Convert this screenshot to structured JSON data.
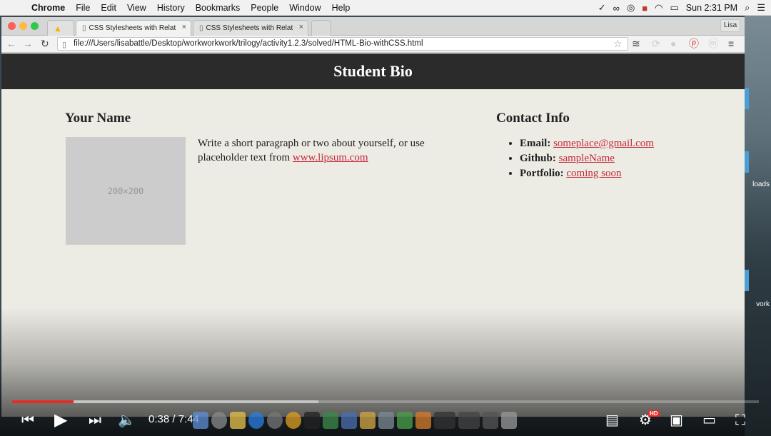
{
  "menubar": {
    "app": "Chrome",
    "items": [
      "File",
      "Edit",
      "View",
      "History",
      "Bookmarks",
      "People",
      "Window",
      "Help"
    ],
    "clock": "Sun 2:31 PM"
  },
  "desktop": {
    "labels": [
      "loads",
      "vork"
    ]
  },
  "browser": {
    "tabs": [
      {
        "title": "CSS Stylesheets with Relat",
        "active": true
      },
      {
        "title": "CSS Stylesheets with Relat",
        "active": false
      }
    ],
    "profile": "Lisa",
    "url": "file:///Users/lisabattle/Desktop/workworkwork/trilogy/activity1.2.3/solved/HTML-Bio-withCSS.html"
  },
  "page": {
    "header": "Student Bio",
    "name_heading": "Your Name",
    "photo_placeholder": "200×200",
    "bio_text": "Write a short paragraph or two about yourself, or use placeholder text from ",
    "bio_link": "www.lipsum.com",
    "contact_heading": "Contact Info",
    "contacts": [
      {
        "label": "Email:",
        "value": "someplace@gmail.com"
      },
      {
        "label": "Github:",
        "value": "sampleName"
      },
      {
        "label": "Portfolio:",
        "value": "coming soon"
      }
    ],
    "link_color": "#c6283a"
  },
  "video": {
    "time": "0:38 / 7:44",
    "progress_fraction": 0.082,
    "buffered_fraction": 0.41,
    "hd_badge": "HD"
  },
  "colors": {
    "header_bg": "#2b2b2b",
    "page_bg": "#ecebe4",
    "progress": "#e52d27"
  }
}
